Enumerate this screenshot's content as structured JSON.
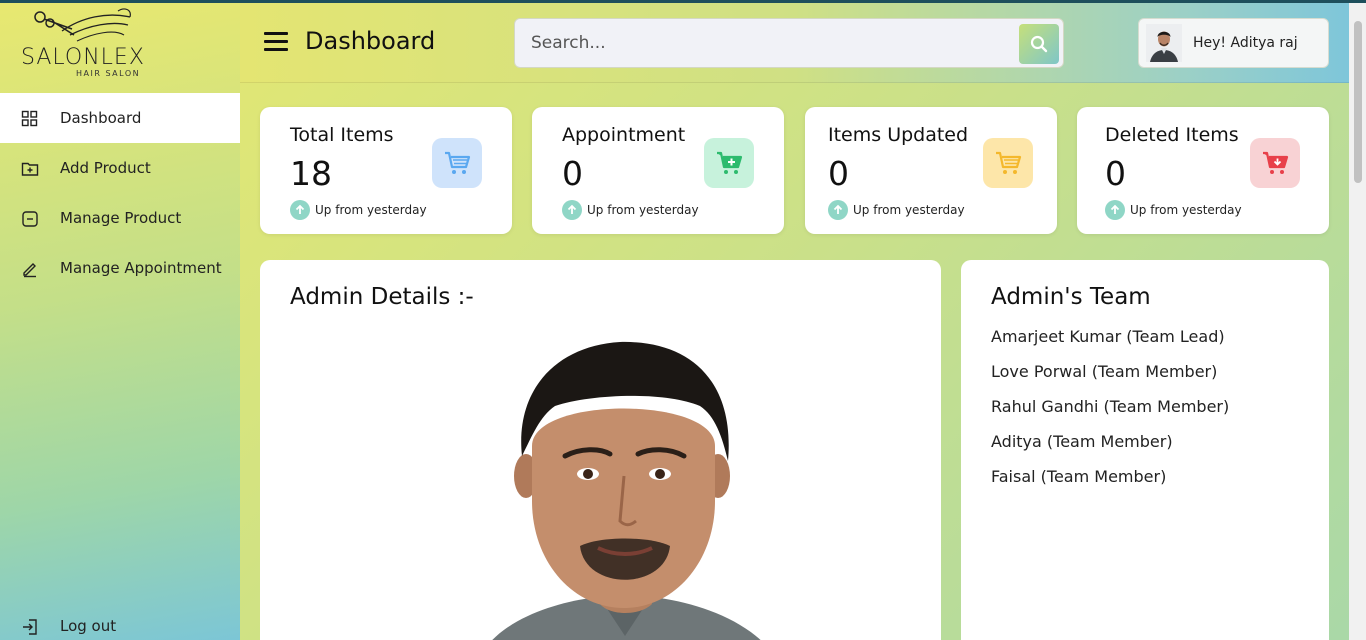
{
  "brand": {
    "name": "SALONLEX",
    "tagline": "HAIR SALON"
  },
  "sidebar": {
    "items": [
      {
        "label": "Dashboard",
        "icon": "grid-icon",
        "active": true
      },
      {
        "label": "Add Product",
        "icon": "folder-plus-icon",
        "active": false
      },
      {
        "label": "Manage Product",
        "icon": "minus-box-icon",
        "active": false
      },
      {
        "label": "Manage Appointment",
        "icon": "pencil-icon",
        "active": false
      }
    ],
    "logout": {
      "label": "Log out",
      "icon": "logout-icon"
    }
  },
  "header": {
    "title": "Dashboard",
    "search_placeholder": "Search...",
    "greeting": "Hey! Aditya raj"
  },
  "cards": [
    {
      "title": "Total Items",
      "value": "18",
      "note": "Up from yesterday",
      "icon": "cart-icon",
      "icon_bg": "#cfe3fb",
      "icon_color": "#5aa8f0"
    },
    {
      "title": "Appointment",
      "value": "0",
      "note": "Up from yesterday",
      "icon": "cart-plus-icon",
      "icon_bg": "#c7f2dc",
      "icon_color": "#2dbb6e"
    },
    {
      "title": "Items Updated",
      "value": "0",
      "note": "Up from yesterday",
      "icon": "cart-icon",
      "icon_bg": "#fde6a9",
      "icon_color": "#f4b82c"
    },
    {
      "title": "Deleted Items",
      "value": "0",
      "note": "Up from yesterday",
      "icon": "cart-remove-icon",
      "icon_bg": "#f8d2d4",
      "icon_color": "#e8404a"
    }
  ],
  "admin_details": {
    "title": "Admin Details :-"
  },
  "team": {
    "title": "Admin's Team",
    "members": [
      "Amarjeet Kumar (Team Lead)",
      "Love Porwal (Team Member)",
      "Rahul Gandhi (Team Member)",
      "Aditya (Team Member)",
      "Faisal (Team Member)"
    ]
  }
}
